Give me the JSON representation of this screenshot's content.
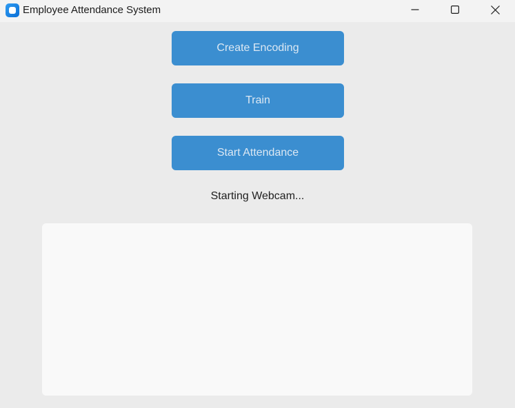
{
  "window": {
    "title": "Employee Attendance System",
    "icon": "app-icon"
  },
  "buttons": {
    "create_encoding": "Create Encoding",
    "train": "Train",
    "start_attendance": "Start Attendance"
  },
  "status": {
    "text": "Starting Webcam..."
  },
  "colors": {
    "button_bg": "#3b8ed0",
    "button_text": "#dce8f3",
    "window_bg": "#ebebeb",
    "titlebar_bg": "#f3f3f3",
    "panel_bg": "#f9f9f9"
  }
}
